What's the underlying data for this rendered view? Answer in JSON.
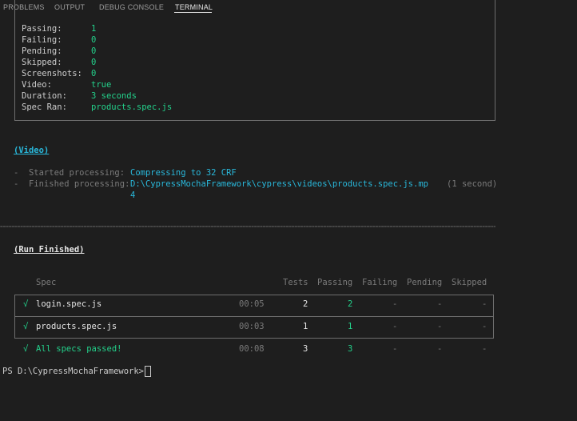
{
  "tabs": [
    "PROBLEMS",
    "OUTPUT",
    "DEBUG CONSOLE",
    "TERMINAL"
  ],
  "results": [
    {
      "label": "Passing:",
      "value": "1"
    },
    {
      "label": "Failing:",
      "value": "0"
    },
    {
      "label": "Pending:",
      "value": "0"
    },
    {
      "label": "Skipped:",
      "value": "0"
    },
    {
      "label": "Screenshots:",
      "value": "0"
    },
    {
      "label": "Video:",
      "value": "true"
    },
    {
      "label": "Duration:",
      "value": "3 seconds"
    },
    {
      "label": "Spec Ran:",
      "value": "products.spec.js"
    }
  ],
  "video": {
    "title": "(Video)",
    "started_label": "-  Started processing:",
    "started_value": "Compressing to 32 CRF",
    "finished_label": "-  Finished processing:",
    "finished_value": "D:\\CypressMochaFramework\\cypress\\videos\\products.spec.js.mp",
    "finished_value_wrap": "4",
    "finished_time": "(1 second)"
  },
  "separator": "================================================================================================",
  "run_finished": {
    "title": "(Run Finished)",
    "headers": {
      "spec": "Spec",
      "tests": "Tests",
      "passing": "Passing",
      "failing": "Failing",
      "pending": "Pending",
      "skipped": "Skipped"
    },
    "rows": [
      {
        "check": "√",
        "spec": "login.spec.js",
        "time": "00:05",
        "tests": "2",
        "passing": "2",
        "failing": "-",
        "pending": "-",
        "skipped": "-"
      },
      {
        "check": "√",
        "spec": "products.spec.js",
        "time": "00:03",
        "tests": "1",
        "passing": "1",
        "failing": "-",
        "pending": "-",
        "skipped": "-"
      }
    ],
    "summary": {
      "check": "√",
      "label": "All specs passed!",
      "time": "00:08",
      "tests": "3",
      "passing": "3",
      "failing": "-",
      "pending": "-",
      "skipped": "-"
    }
  },
  "prompt": "PS D:\\CypressMochaFramework>"
}
